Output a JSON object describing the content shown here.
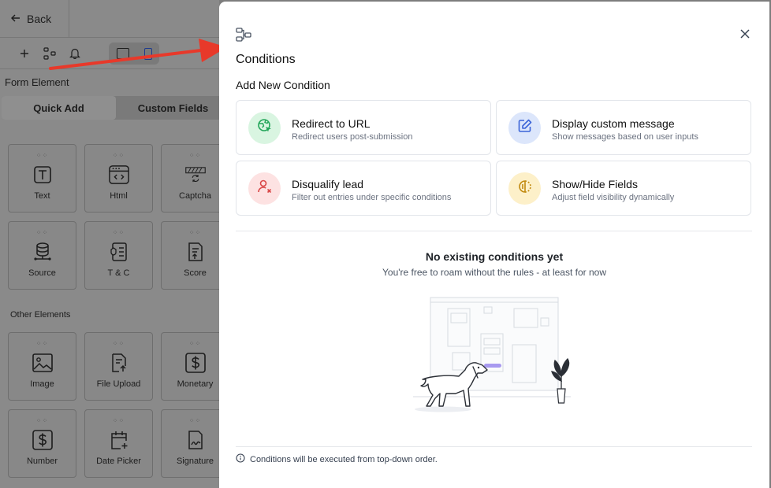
{
  "builder": {
    "back_label": "Back",
    "form_element_label": "Form Element",
    "tabs": [
      "Quick Add",
      "Custom Fields"
    ],
    "quick_tiles": [
      {
        "label": "Text",
        "icon": "text-t-icon"
      },
      {
        "label": "Html",
        "icon": "html-code-icon"
      },
      {
        "label": "Captcha",
        "icon": "captcha-icon"
      },
      {
        "label": "Source",
        "icon": "database-icon"
      },
      {
        "label": "T & C",
        "icon": "terms-icon"
      },
      {
        "label": "Score",
        "icon": "score-icon"
      }
    ],
    "other_elements_label": "Other Elements",
    "other_tiles": [
      {
        "label": "Image",
        "icon": "image-icon"
      },
      {
        "label": "File Upload",
        "icon": "file-upload-icon"
      },
      {
        "label": "Monetary",
        "icon": "dollar-icon"
      },
      {
        "label": "Number",
        "icon": "number-dollar-icon"
      },
      {
        "label": "Date Picker",
        "icon": "calendar-plus-icon"
      },
      {
        "label": "Signature",
        "icon": "signature-icon"
      }
    ]
  },
  "modal": {
    "title": "Conditions",
    "section_title": "Add New Condition",
    "cards": [
      {
        "title": "Redirect to URL",
        "desc": "Redirect users post-submission",
        "icon": "globe-cursor-icon",
        "color": "#d9f5e1",
        "iconColor": "#22a559"
      },
      {
        "title": "Display custom message",
        "desc": "Show messages based on user inputs",
        "icon": "edit-icon",
        "color": "#dce6fb",
        "iconColor": "#3b64d8"
      },
      {
        "title": "Disqualify lead",
        "desc": "Filter out entries under specific conditions",
        "icon": "user-x-icon",
        "color": "#fde2e2",
        "iconColor": "#d94848"
      },
      {
        "title": "Show/Hide Fields",
        "desc": "Adjust field visibility dynamically",
        "icon": "visibility-half-icon",
        "color": "#fdf0c9",
        "iconColor": "#c28a10"
      }
    ],
    "empty_title": "No existing conditions yet",
    "empty_subtitle": "You're free to roam without the rules - at least for now",
    "footer_note": "Conditions will be executed from top-down order."
  },
  "colors": {
    "arrow": "#e8392a",
    "overlay": "#8a8a8a"
  }
}
